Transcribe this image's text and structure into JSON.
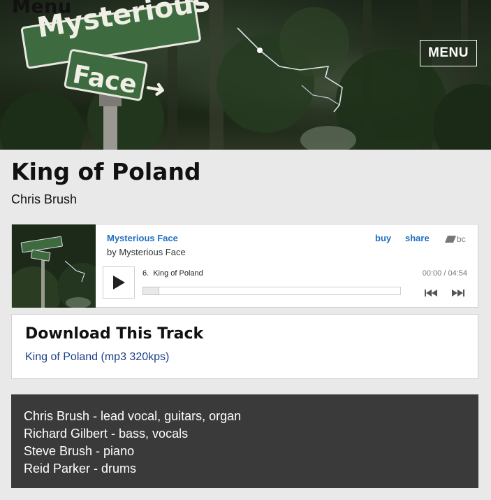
{
  "site": {
    "title": "Menu",
    "menu_label": "MENU"
  },
  "hero": {
    "sign_top": "Mysterious",
    "sign_bottom": "Face"
  },
  "track": {
    "title": "King of Poland",
    "artist": "Chris Brush"
  },
  "player": {
    "album": "Mysterious Face",
    "by_line": "by Mysterious Face",
    "buy_label": "buy",
    "share_label": "share",
    "logo_label": "bc",
    "track_number": "6.",
    "track_name": "King of Poland",
    "time": "00:00 / 04:54",
    "progress": 0
  },
  "download": {
    "heading": "Download This Track",
    "link_label": "King of Poland (mp3 320kps)"
  },
  "credits": [
    "Chris Brush - lead vocal, guitars, organ",
    "Richard Gilbert - bass, vocals",
    "Steve Brush - piano",
    "Reid Parker - drums"
  ],
  "colors": {
    "link_blue": "#1f6fc0",
    "dark_panel": "#3a3a3a",
    "sign_green": "#3d6a3f"
  }
}
